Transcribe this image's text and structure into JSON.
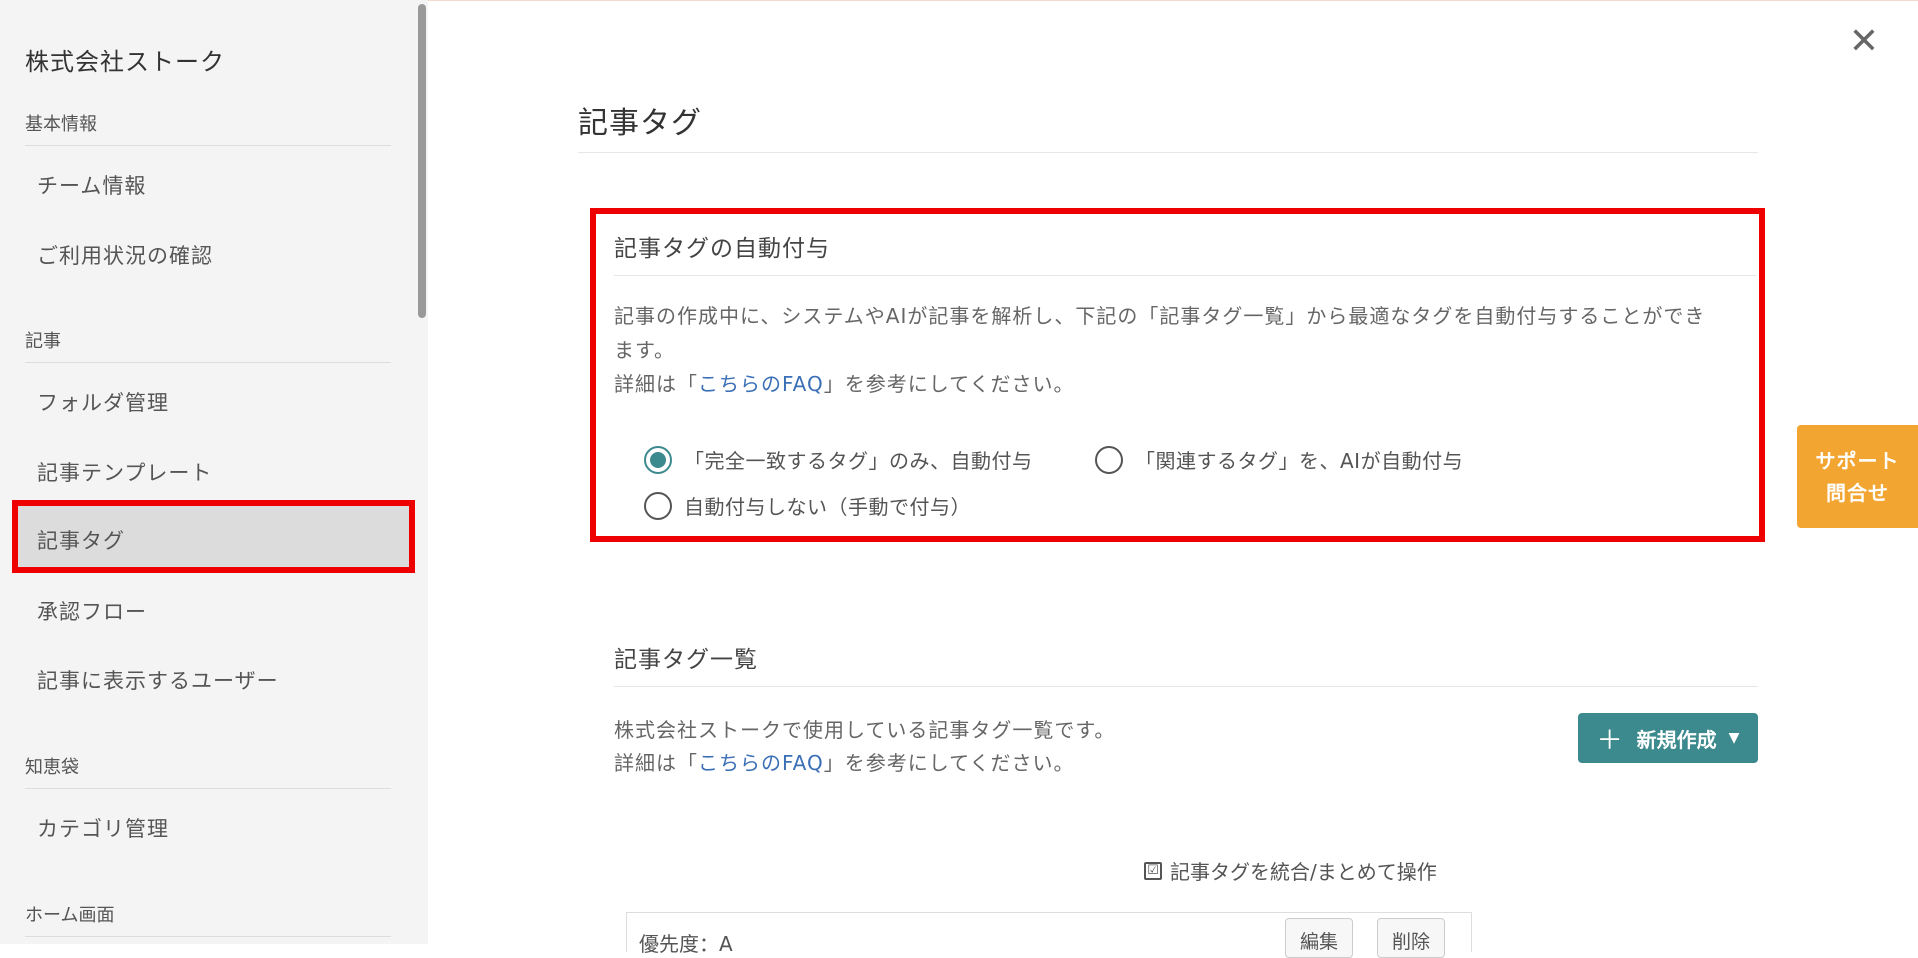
{
  "sidebar": {
    "company": "株式会社ストーク",
    "sections": [
      {
        "label": "基本情報",
        "items": [
          "チーム情報",
          "ご利用状況の確認"
        ]
      },
      {
        "label": "記事",
        "items": [
          "フォルダ管理",
          "記事テンプレート",
          "記事タグ",
          "承認フロー",
          "記事に表示するユーザー"
        ]
      },
      {
        "label": "知恵袋",
        "items": [
          "カテゴリ管理"
        ]
      },
      {
        "label": "ホーム画面",
        "items": []
      }
    ],
    "active_item": "記事タグ"
  },
  "main": {
    "close_label": "✕",
    "title": "記事タグ",
    "auto_assign": {
      "title": "記事タグの自動付与",
      "desc_line1": "記事の作成中に、システムやAIが記事を解析し、下記の「記事タグ一覧」から最適なタグを自動付与することができ",
      "desc_line2": "ます。",
      "faq_prefix": "詳細は「",
      "faq_link": "こちらのFAQ",
      "faq_suffix": "」を参考にしてください。",
      "options": [
        {
          "label": "「完全一致するタグ」のみ、自動付与",
          "checked": true
        },
        {
          "label": "「関連するタグ」を、AIが自動付与",
          "checked": false
        },
        {
          "label": "自動付与しない（手動で付与）",
          "checked": false
        }
      ]
    },
    "tag_list": {
      "title": "記事タグ一覧",
      "desc": "株式会社ストークで使用している記事タグ一覧です。",
      "faq_prefix": "詳細は「",
      "faq_link": "こちらのFAQ",
      "faq_suffix": "」を参考にしてください。",
      "new_button": {
        "plus": "＋",
        "label": "新規作成",
        "caret": "▼"
      },
      "bulk_op": {
        "icon": "☑",
        "label": "記事タグを統合/まとめて操作"
      },
      "first_tag": {
        "priority": "優先度：A",
        "edit": "編集",
        "delete": "削除"
      }
    }
  },
  "support": {
    "line1": "サポート",
    "line2": "問合せ"
  },
  "colors": {
    "accent": "#3d8a8e",
    "highlight": "#ee0000",
    "support": "#f2a530",
    "link": "#3b6fb6"
  }
}
